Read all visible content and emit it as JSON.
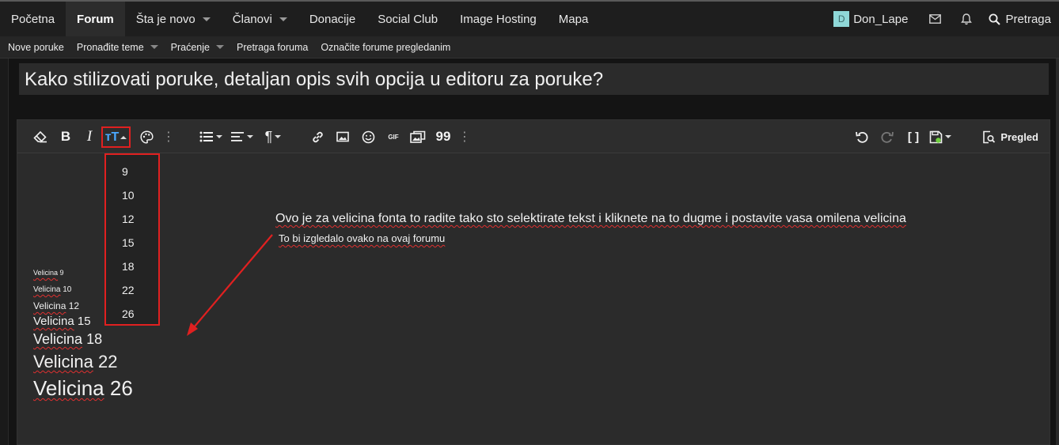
{
  "topnav": {
    "tabs": [
      {
        "label": "Početna",
        "caret": false
      },
      {
        "label": "Forum",
        "caret": false
      },
      {
        "label": "Šta je novo",
        "caret": true
      },
      {
        "label": "Članovi",
        "caret": true
      },
      {
        "label": "Donacije",
        "caret": false
      },
      {
        "label": "Social Club",
        "caret": false
      },
      {
        "label": "Image Hosting",
        "caret": false
      },
      {
        "label": "Mapa",
        "caret": false
      }
    ],
    "avatar_letter": "D",
    "username": "Don_Lape",
    "search_label": "Pretraga"
  },
  "subnav": {
    "items": [
      "Nove poruke",
      "Pronađite teme",
      "Praćenje",
      "Pretraga foruma",
      "Označite forume pregledanim"
    ]
  },
  "thread_title": "Kako stilizovati poruke, detaljan opis svih opcija u editoru za poruke?",
  "toolbar": {
    "bold": "B",
    "italic": "I",
    "font_size_glyph": "тT",
    "heading_glyph": "¶",
    "gif": "GIF",
    "quote_glyph": "99",
    "source_glyph": "[ ]",
    "preview_label": "Pregled"
  },
  "font_size_dropdown": [
    "9",
    "10",
    "12",
    "15",
    "18",
    "22",
    "26"
  ],
  "content": {
    "samples": [
      {
        "word": "Velicina",
        "size": "9"
      },
      {
        "word": "Velicina",
        "size": "10"
      },
      {
        "word": "Velicina",
        "size": "12"
      },
      {
        "word": "Velicina",
        "size": "15"
      },
      {
        "word": "Velicina",
        "size": "18"
      },
      {
        "word": "Velicina",
        "size": "22"
      },
      {
        "word": "Velicina",
        "size": "26"
      }
    ],
    "note_line1": "Ovo je za velicina fonta to radite tako sto selektirate tekst i kliknete na to dugme i postavite vasa omilena velicina",
    "note_line2": "To bi izgledalo ovako na ovaj forumu"
  },
  "colors": {
    "highlight": "#e02020",
    "accent": "#4aa8ff",
    "avatar": "#8fd8d8"
  }
}
